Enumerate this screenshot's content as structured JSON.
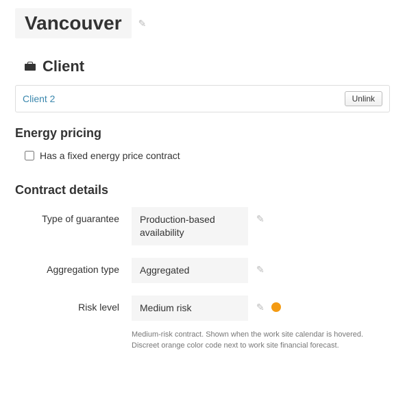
{
  "title": "Vancouver",
  "clientSection": {
    "heading": "Client",
    "linkedClient": "Client 2",
    "unlinkLabel": "Unlink"
  },
  "energyPricing": {
    "heading": "Energy pricing",
    "fixedPriceLabel": "Has a fixed energy price contract",
    "fixedPriceChecked": false
  },
  "contractDetails": {
    "heading": "Contract details",
    "guarantee": {
      "label": "Type of guarantee",
      "value": "Production-based availability"
    },
    "aggregation": {
      "label": "Aggregation type",
      "value": "Aggregated"
    },
    "risk": {
      "label": "Risk level",
      "value": "Medium risk",
      "dotColor": "#f49b13",
      "help": "Medium-risk contract. Shown when the work site calendar is hovered. Discreet orange color code next to work site financial forecast."
    }
  }
}
